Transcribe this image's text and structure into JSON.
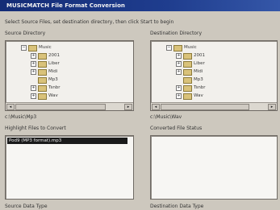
{
  "title": "MUSICMATCH File Format Conversion",
  "instruction": "Select Source Files, set destination directory, then click Start to begin",
  "source_dir_label": "Source Directory",
  "dest_dir_label": "Destination Directory",
  "source_tree": [
    {
      "label": "Music",
      "level": 0,
      "expander": "-"
    },
    {
      "label": "2001",
      "level": 1,
      "expander": "+"
    },
    {
      "label": "Liber",
      "level": 1,
      "expander": "+"
    },
    {
      "label": "Midi",
      "level": 1,
      "expander": "+"
    },
    {
      "label": "Mp3",
      "level": 1,
      "expander": ""
    },
    {
      "label": "Tsnbr",
      "level": 1,
      "expander": "+"
    },
    {
      "label": "Wav",
      "level": 1,
      "expander": "+"
    }
  ],
  "dest_tree": [
    {
      "label": "Music",
      "level": 0,
      "expander": "-"
    },
    {
      "label": "2001",
      "level": 1,
      "expander": "+"
    },
    {
      "label": "Liber",
      "level": 1,
      "expander": "+"
    },
    {
      "label": "Midi",
      "level": 1,
      "expander": "+"
    },
    {
      "label": "Mp3",
      "level": 1,
      "expander": ""
    },
    {
      "label": "Tsnbr",
      "level": 1,
      "expander": "+"
    },
    {
      "label": "Wav",
      "level": 1,
      "expander": "+"
    }
  ],
  "source_path": "c:\\Music\\Mp3",
  "dest_path": "c:\\Music\\Wav",
  "highlight_label": "Highlight Files to Convert",
  "converted_label": "Converted File Status",
  "highlighted_file": "Pod9 (MP3 format).mp3",
  "source_type_label": "Source Data Type",
  "dest_type_label": "Destination Data Type",
  "colors": {
    "titlebar": "#1f3d8e",
    "selection": "#1a1a1a",
    "window": "#cdc8be"
  }
}
